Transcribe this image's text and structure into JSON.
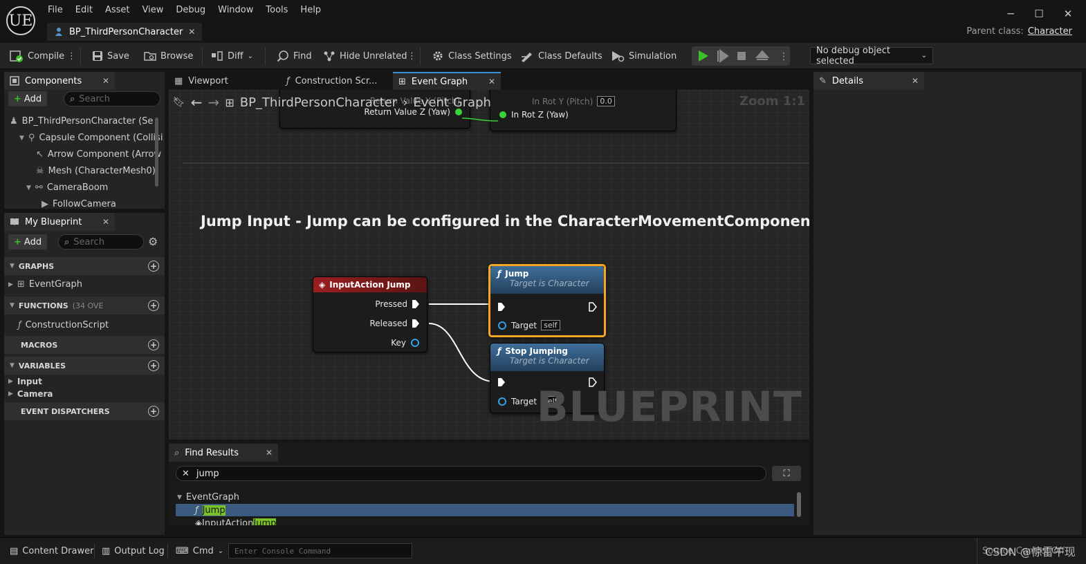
{
  "app": {
    "logo": "UE",
    "menus": [
      "File",
      "Edit",
      "Asset",
      "View",
      "Debug",
      "Window",
      "Tools",
      "Help"
    ],
    "document_tab": "BP_ThirdPersonCharacter",
    "parent_class_label": "Parent class:",
    "parent_class_value": "Character"
  },
  "toolbar": {
    "compile": "Compile",
    "save": "Save",
    "browse": "Browse",
    "diff": "Diff",
    "find": "Find",
    "hide_unrelated": "Hide Unrelated",
    "class_settings": "Class Settings",
    "class_defaults": "Class Defaults",
    "simulation": "Simulation",
    "debug_object": "No debug object selected"
  },
  "components": {
    "tab": "Components",
    "add": "Add",
    "search_placeholder": "Search",
    "items": [
      {
        "label": "BP_ThirdPersonCharacter (Se",
        "icon": "pawn-icon"
      },
      {
        "label": "Capsule Component (Collisi",
        "icon": "capsule-icon"
      },
      {
        "label": "Arrow Component (Arrow",
        "icon": "arrow-icon"
      },
      {
        "label": "Mesh (CharacterMesh0)",
        "icon": "skeleton-icon"
      },
      {
        "label": "CameraBoom",
        "icon": "spring-arm-icon"
      },
      {
        "label": "FollowCamera",
        "icon": "camera-icon"
      }
    ]
  },
  "my_blueprint": {
    "tab": "My Blueprint",
    "add": "Add",
    "search_placeholder": "Search",
    "graphs_header": "GRAPHS",
    "event_graph": "EventGraph",
    "functions_header": "FUNCTIONS",
    "functions_count": "(34 OVE",
    "construction_script": "ConstructionScript",
    "macros_header": "MACROS",
    "variables_header": "VARIABLES",
    "var_input": "Input",
    "var_camera": "Camera",
    "dispatchers_header": "EVENT DISPATCHERS"
  },
  "editor_tabs": {
    "viewport": "Viewport",
    "construction": "Construction Scr...",
    "event_graph": "Event Graph"
  },
  "graph": {
    "breadcrumb_root": "BP_ThirdPersonCharacter",
    "breadcrumb_leaf": "Event Graph",
    "zoom": "Zoom 1:1",
    "ghost_left": "Return Value Y (Pitch)",
    "ghost_right": "In Rot Y (Pitch)",
    "ghost_value": "0.0",
    "return_value_z": "Return Value Z (Yaw)",
    "in_rot_z": "In Rot Z (Yaw)",
    "comment": "Jump Input - Jump can be configured in the CharacterMovementComponent",
    "input_node": {
      "title": "InputAction Jump",
      "pressed": "Pressed",
      "released": "Released",
      "key": "Key"
    },
    "jump_node": {
      "title": "Jump",
      "subtitle": "Target is Character",
      "target": "Target",
      "self": "self"
    },
    "stop_node": {
      "title": "Stop Jumping",
      "subtitle": "Target is Character",
      "target": "Target",
      "self": "self"
    },
    "watermark": "BLUEPRINT"
  },
  "details": {
    "tab": "Details"
  },
  "find_results": {
    "tab": "Find Results",
    "query": "jump",
    "group": "EventGraph",
    "result1": "Jump",
    "result2_prefix": "InputAction ",
    "result2_match": "Jump"
  },
  "status": {
    "content_drawer": "Content Drawer",
    "output_log": "Output Log",
    "cmd": "Cmd",
    "console_placeholder": "Enter Console Command",
    "source_control": "Source Control Off",
    "watermark": "CSDN @惊雷午现"
  },
  "colors": {
    "exec_white": "#ffffff",
    "vector_green": "#3ad13a",
    "object_blue": "#34a0e8",
    "input_node_header": "#8f1f1f",
    "func_header": "#3e6e9a",
    "selection_orange": "#f5a623",
    "play_green": "#3bbf2a",
    "search_match": "#7cc32b"
  }
}
